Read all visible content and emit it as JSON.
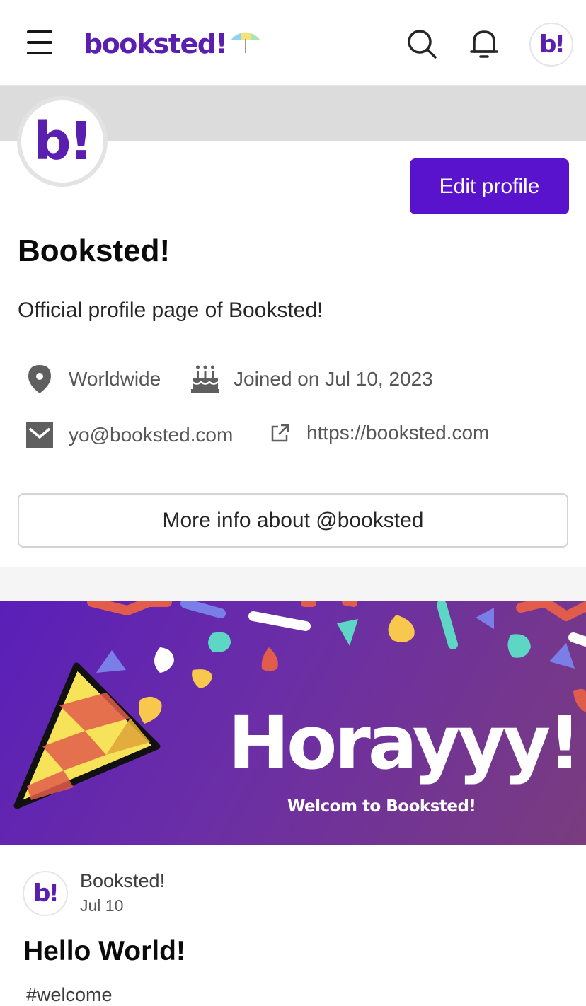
{
  "header": {
    "logo_text": "booksted!",
    "avatar_text": "b!"
  },
  "profile": {
    "avatar_text": "b!",
    "edit_label": "Edit profile",
    "name": "Booksted!",
    "bio": "Official profile page of Booksted!",
    "location": "Worldwide",
    "joined": "Joined on Jul 10, 2023",
    "email": "yo@booksted.com",
    "website": "https://booksted.com",
    "more_info_label": "More info about @booksted"
  },
  "banner": {
    "title": "Horayyy!",
    "subtitle": "Welcom to Booksted!"
  },
  "post": {
    "avatar_text": "b!",
    "author": "Booksted!",
    "date": "Jul 10",
    "title": "Hello World!",
    "tag": "#welcome"
  },
  "colors": {
    "brand": "#5b1fb0",
    "button": "#5a13cc",
    "banner_start": "#5a1fb8",
    "banner_end": "#7a3c7e"
  },
  "icons": [
    "menu-icon",
    "search-icon",
    "bell-icon",
    "location-pin-icon",
    "cake-icon",
    "mail-icon",
    "external-link-icon",
    "party-popper-icon",
    "umbrella-icon"
  ]
}
